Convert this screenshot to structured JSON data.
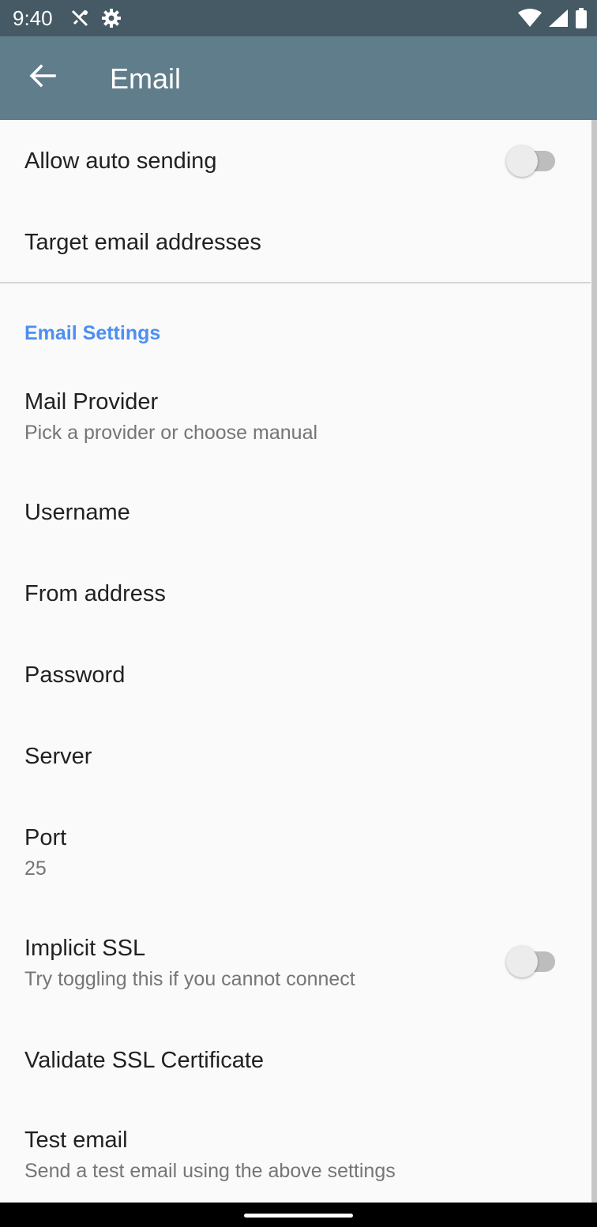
{
  "status_bar": {
    "time": "9:40",
    "icons_left": [
      "no-signal-tools-icon",
      "settings-gear-icon"
    ],
    "icons_right": [
      "wifi-icon",
      "cellular-signal-icon",
      "battery-icon"
    ]
  },
  "app_bar": {
    "title": "Email",
    "back_icon": "arrow-left-icon",
    "color": "#607d8b"
  },
  "prefs_top": [
    {
      "title": "Allow auto sending",
      "switch": "off"
    },
    {
      "title": "Target email addresses"
    }
  ],
  "category": {
    "title": "Email Settings",
    "color": "#4d8ff0"
  },
  "prefs": [
    {
      "title": "Mail Provider",
      "summary": "Pick a provider or choose manual"
    },
    {
      "title": "Username"
    },
    {
      "title": "From address"
    },
    {
      "title": "Password"
    },
    {
      "title": "Server"
    },
    {
      "title": "Port",
      "summary": "25"
    },
    {
      "title": "Implicit SSL",
      "summary": "Try toggling this if you cannot connect",
      "switch": "off"
    },
    {
      "title": "Validate SSL Certificate"
    },
    {
      "title": "Test email",
      "summary": "Send a test email using the above settings"
    }
  ]
}
